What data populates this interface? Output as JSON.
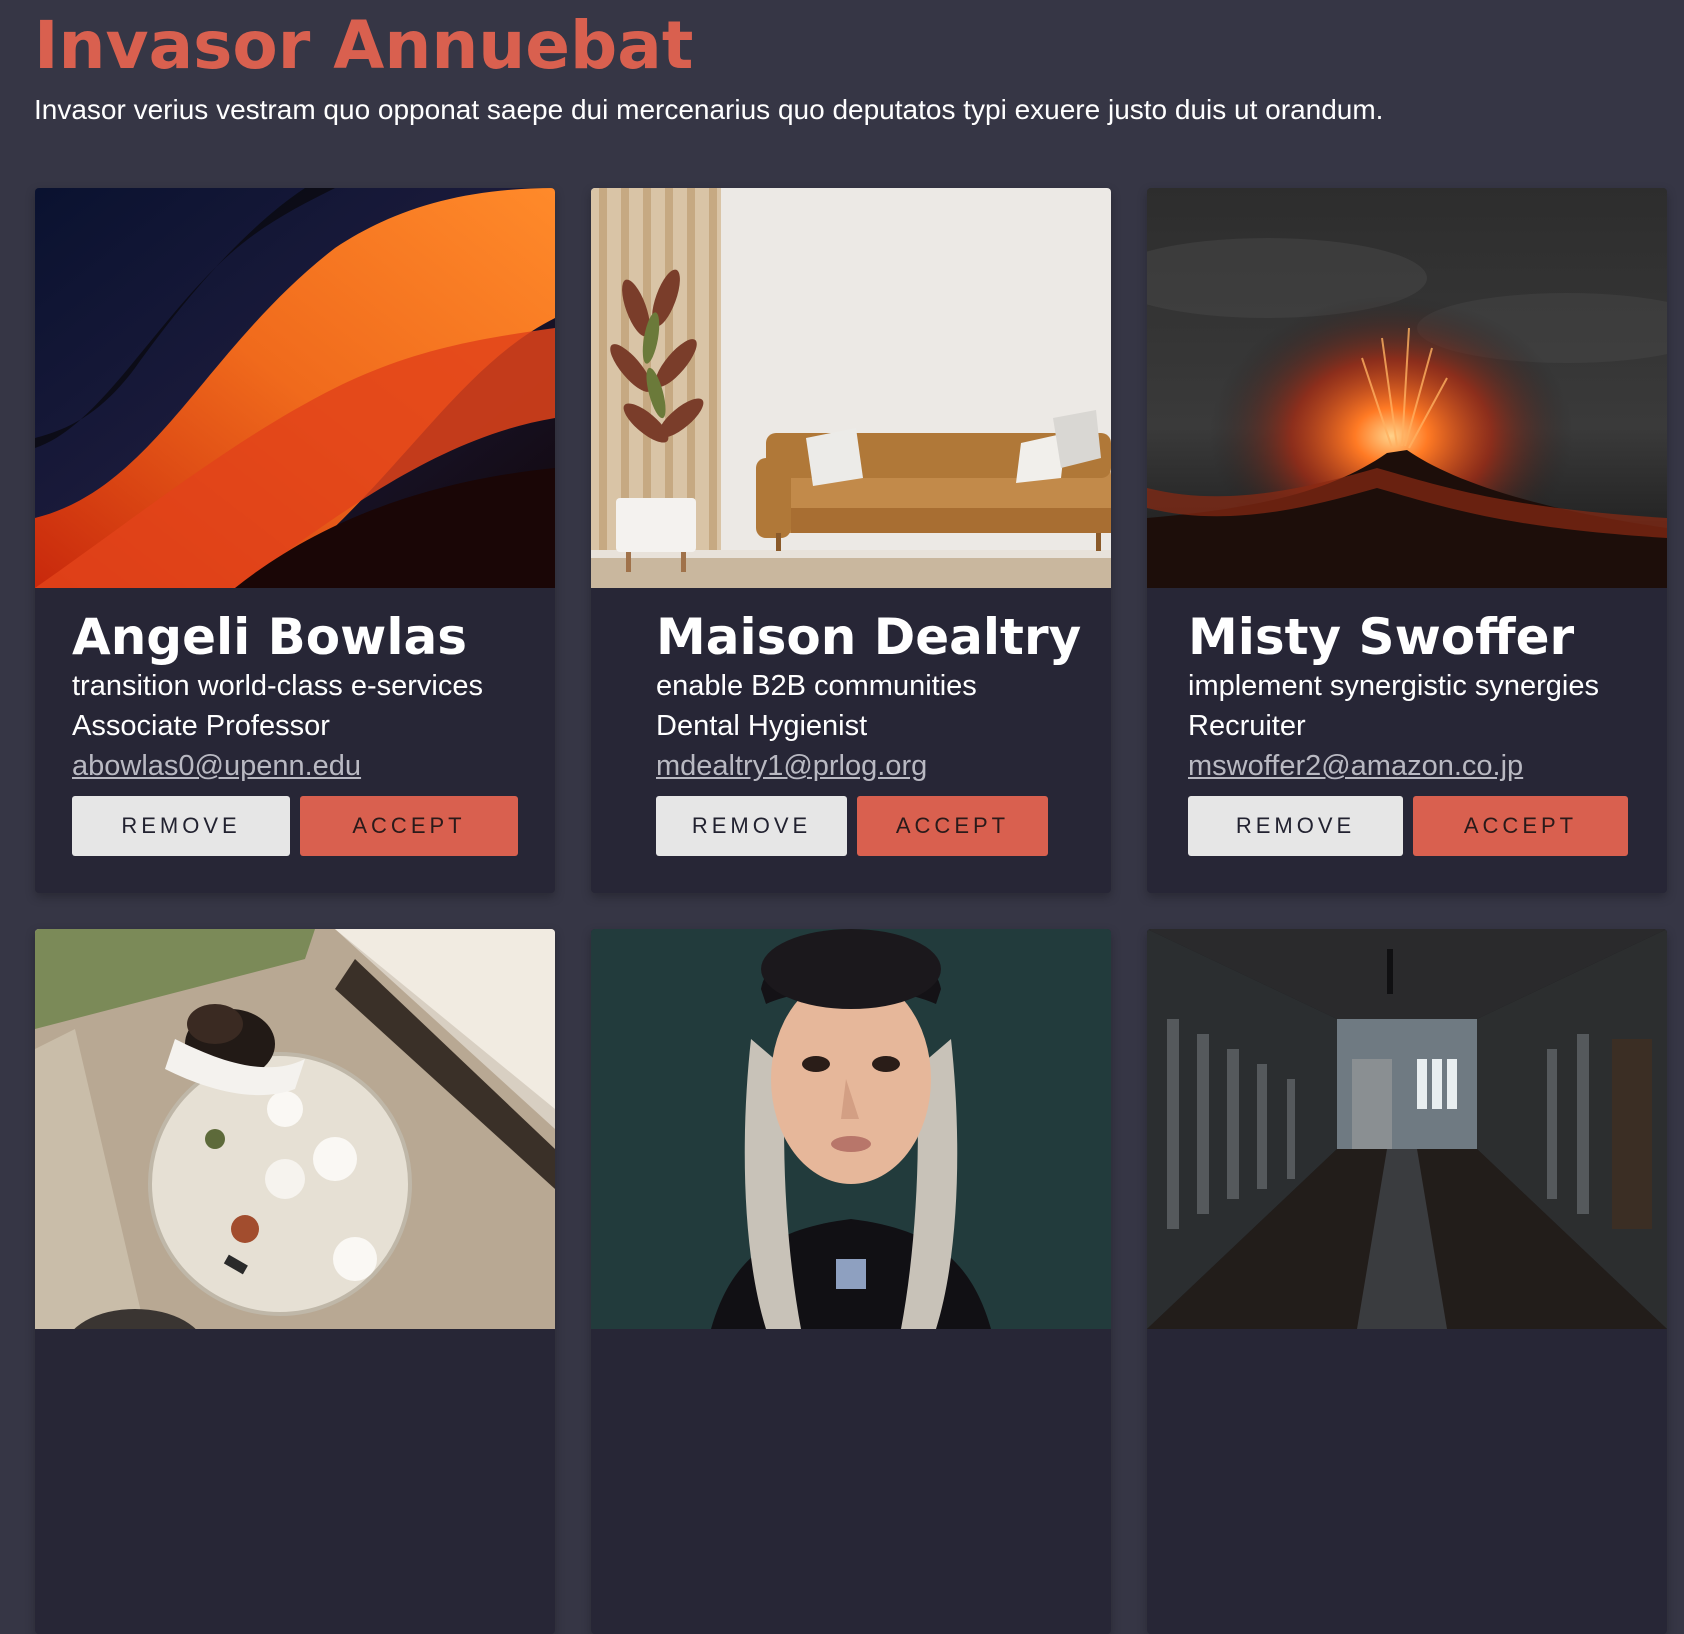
{
  "header": {
    "title": "Invasor Annuebat",
    "subtitle": "Invasor verius vestram quo opponat saepe dui mercenarius quo deputatos typi exuere justo duis ut orandum."
  },
  "colors": {
    "background": "#363645",
    "card": "#272636",
    "accent": "#d9604f",
    "remove_button": "#e6e6e6"
  },
  "cards": [
    {
      "name": "Angeli Bowlas",
      "tagline": "transition world-class e-services",
      "job": "Associate Professor",
      "email": "abowlas0@upenn.edu",
      "remove_label": "REMOVE",
      "accept_label": "ACCEPT",
      "image": "abstract-orange-wave"
    },
    {
      "name": "Maison Dealtry",
      "tagline": "enable B2B communities",
      "job": "Dental Hygienist",
      "email": "mdealtry1@prlog.org",
      "remove_label": "REMOVE",
      "accept_label": "ACCEPT",
      "image": "living-room-sofa"
    },
    {
      "name": "Misty Swoffer",
      "tagline": "implement synergistic synergies",
      "job": "Recruiter",
      "email": "mswoffer2@amazon.co.jp",
      "remove_label": "REMOVE",
      "accept_label": "ACCEPT",
      "image": "erupting-volcano"
    },
    {
      "image": "cafe-table-overhead"
    },
    {
      "image": "woman-portrait"
    },
    {
      "image": "dark-hallway"
    }
  ]
}
